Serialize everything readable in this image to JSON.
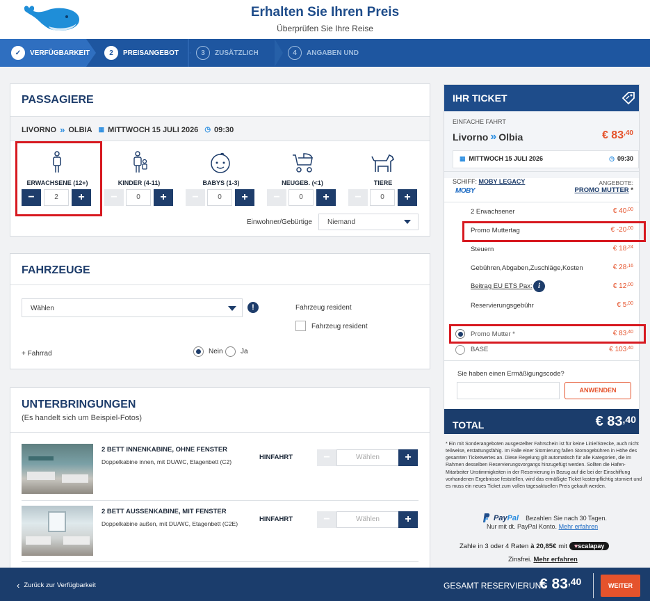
{
  "header": {
    "title": "Erhalten Sie Ihren Preis",
    "subtitle": "Überprüfen Sie Ihre Reise"
  },
  "steps": [
    {
      "num": "✓",
      "label": "VERFÜGBARKEIT"
    },
    {
      "num": "2",
      "label": "PREISANGEBOT"
    },
    {
      "num": "3",
      "label": "ZUSÄTZLICH"
    },
    {
      "num": "4",
      "label": "ANGABEN UND"
    }
  ],
  "passengers": {
    "title": "PASSAGIERE",
    "from": "LIVORNO",
    "to": "OLBIA",
    "date": "MITTWOCH 15 JULI 2026",
    "time": "09:30",
    "types": [
      {
        "label": "ERWACHSENE (12+)",
        "qty": "2"
      },
      {
        "label": "KINDER (4-11)",
        "qty": "0"
      },
      {
        "label": "BABYS (1-3)",
        "qty": "0"
      },
      {
        "label": "NEUGEB. (<1)",
        "qty": "0"
      },
      {
        "label": "TIERE",
        "qty": "0"
      }
    ],
    "resident_label": "Einwohner/Gebürtige",
    "resident_value": "Niemand"
  },
  "vehicles": {
    "title": "FAHRZEUGE",
    "select": "Wählen",
    "resident_title": "Fahrzeug resident",
    "resident_checkbox": "Fahrzeug resident",
    "bike": "+ Fahrrad",
    "no": "Nein",
    "yes": "Ja"
  },
  "accommodations": {
    "title": "UNTERBRINGUNGEN",
    "subtitle": "(Es handelt sich um Beispiel-Fotos)",
    "items": [
      {
        "name": "2 BETT INNENKABINE, OHNE FENSTER",
        "desc": "Doppelkabine innen, mit DU/WC, Etagenbett (C2)",
        "dir": "HINFAHRT",
        "select": "Wählen"
      },
      {
        "name": "2 BETT AUSSENKABINE, MIT FENSTER",
        "desc": "Doppelkabine außen, mit DU/WC, Etagenbett (C2E)",
        "dir": "HINFAHRT",
        "select": "Wählen"
      }
    ]
  },
  "ticket": {
    "title": "IHR TICKET",
    "trip_type": "EINFACHE FAHRT",
    "from": "Livorno",
    "to": "Olbia",
    "price_int": "€ 83",
    "price_dec": ",40",
    "date": "MITTWOCH 15 JULI 2026",
    "time": "09:30",
    "ship_label": "SCHIFF:",
    "ship": "MOBY LEGACY",
    "brand": "MOBY",
    "offers_label": "ANGEBOTE:",
    "offer": "PROMO MUTTER",
    "offer_star": "*",
    "lines": [
      {
        "label": "2 Erwachsener",
        "int": "€ 40",
        "dec": ",00"
      },
      {
        "label": "Promo Muttertag",
        "int": "€ -20",
        "dec": ",00"
      },
      {
        "label": "Steuern",
        "int": "€ 18",
        "dec": ",24"
      },
      {
        "label": "Gebühren,Abgaben,Zuschläge,Kosten",
        "int": "€ 28",
        "dec": ",16"
      },
      {
        "label": "Beitrag EU ETS Pax:",
        "int": "€ 12",
        "dec": ",00"
      },
      {
        "label": "Reservierungsgebühr",
        "int": "€ 5",
        "dec": ",00"
      }
    ],
    "fares": [
      {
        "label": "Promo Mutter *",
        "int": "€ 83",
        "dec": ",40"
      },
      {
        "label": "BASE",
        "int": "€ 103",
        "dec": ",40"
      }
    ],
    "discount_q": "Sie haben einen Ermäßigungscode?",
    "apply": "ANWENDEN",
    "total_label": "TOTAL",
    "total_int": "€ 83",
    "total_dec": ",40"
  },
  "note": "* Ein mit Sonderangeboten ausgestellter Fahrschein ist für keine Linie/Strecke, auch nicht teilweise, erstattungsfähig. Im Falle einer Stornierung fallen Stornogebühren in Höhe des gesamten Ticketwertes an. Diese Regelung gilt automatisch für alle Kategorien, die im Rahmen desselben Reservierungsvorgangs hinzugefügt werden. Sollten die Hafen-Mitarbeiter Unstimmigkeiten in der Reservierung in Bezug auf die bei der Einschiffung vorhandenen Ergebnisse feststellen, wird das ermäßigte Ticket kostenpflichtig storniert und es muss ein neues Ticket zum vollen tagesaktuellen Preis gekauft werden.",
  "paypal": {
    "brand1": "Pay",
    "brand2": "Pal",
    "line1": "Bezahlen Sie nach 30 Tagen.",
    "line2": "Nur mit dt. PayPal Konto.",
    "link": "Mehr erfahren"
  },
  "scalapay": {
    "text": "Zahle in 3 oder 4 Raten",
    "amount": "à 20,85€",
    "mit": "mit",
    "brand": "scalapay",
    "line2": "Zinsfrei.",
    "link": "Mehr erfahren"
  },
  "footer": {
    "back": "Zurück zur Verfügbarkeit",
    "total_label": "GESAMT RESERVIERUNG",
    "total_int": "€ 83",
    "total_dec": ",40",
    "next": "WEITER"
  },
  "colors": {
    "navy": "#1e3d6b",
    "blue": "#1e56a0",
    "orange": "#e5532c",
    "highlight": "#d71920"
  }
}
